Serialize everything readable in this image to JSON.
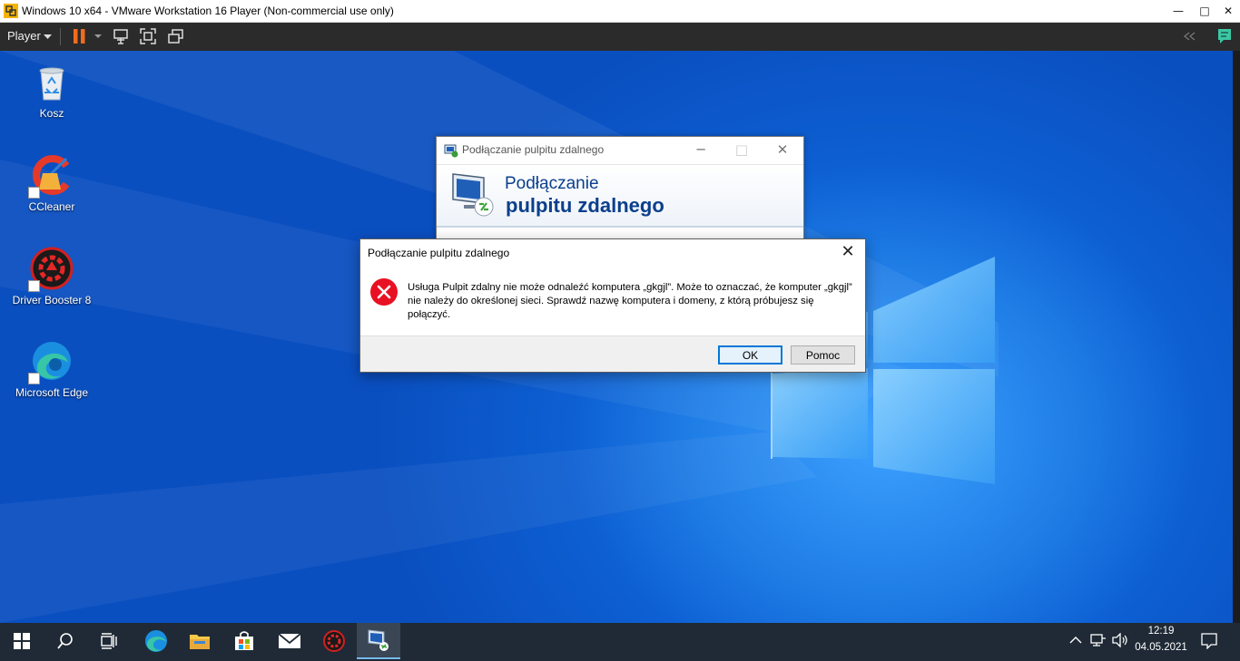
{
  "vmware": {
    "window_title": "Windows 10 x64 - VMware Workstation 16 Player (Non-commercial use only)",
    "player_menu_label": "Player",
    "window_controls": {
      "minimize": "—",
      "maximize": "□",
      "close": "✕"
    }
  },
  "desktop": {
    "icons": [
      {
        "label": "Kosz",
        "icon": "recycle-bin-icon"
      },
      {
        "label": "CCleaner",
        "icon": "ccleaner-icon"
      },
      {
        "label": "Driver Booster 8",
        "icon": "driver-booster-icon"
      },
      {
        "label": "Microsoft Edge",
        "icon": "edge-icon"
      }
    ]
  },
  "rdp_window": {
    "title": "Podłączanie pulpitu zdalnego",
    "banner_line1": "Podłączanie",
    "banner_line2": "pulpitu zdalnego"
  },
  "error_dialog": {
    "title": "Podłączanie pulpitu zdalnego",
    "message": "Usługa Pulpit zdalny nie może odnaleźć komputera „gkgjl”. Może to oznaczać, że komputer „gkgjl” nie należy do określonej sieci. Sprawdź nazwę komputera i domeny, z którą próbujesz się połączyć.",
    "ok_label": "OK",
    "help_label": "Pomoc",
    "icon": "error-icon",
    "accent_color": "#e81123"
  },
  "taskbar": {
    "items": [
      "start-icon",
      "search-icon",
      "task-view-icon",
      "edge-icon",
      "file-explorer-icon",
      "store-icon",
      "mail-icon",
      "driver-booster-icon",
      "remote-desktop-icon"
    ],
    "active_item": "remote-desktop-icon",
    "clock_time": "12:19",
    "clock_date": "04.05.2021"
  }
}
